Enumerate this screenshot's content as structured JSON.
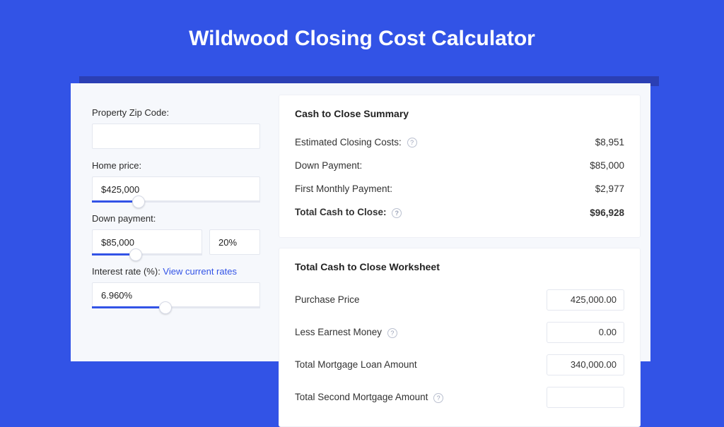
{
  "title": "Wildwood Closing Cost Calculator",
  "left": {
    "zip_label": "Property Zip Code:",
    "zip_value": "",
    "home_price_label": "Home price:",
    "home_price_value": "$425,000",
    "down_payment_label": "Down payment:",
    "down_payment_value": "$85,000",
    "down_payment_pct": "20%",
    "interest_label_prefix": "Interest rate (%): ",
    "interest_link": "View current rates",
    "interest_value": "6.960%"
  },
  "summary": {
    "heading": "Cash to Close Summary",
    "rows": [
      {
        "label": "Estimated Closing Costs:",
        "help": true,
        "value": "$8,951"
      },
      {
        "label": "Down Payment:",
        "help": false,
        "value": "$85,000"
      },
      {
        "label": "First Monthly Payment:",
        "help": false,
        "value": "$2,977"
      }
    ],
    "total_label": "Total Cash to Close:",
    "total_value": "$96,928"
  },
  "worksheet": {
    "heading": "Total Cash to Close Worksheet",
    "rows": [
      {
        "label": "Purchase Price",
        "help": false,
        "value": "425,000.00"
      },
      {
        "label": "Less Earnest Money",
        "help": true,
        "value": "0.00"
      },
      {
        "label": "Total Mortgage Loan Amount",
        "help": false,
        "value": "340,000.00"
      },
      {
        "label": "Total Second Mortgage Amount",
        "help": true,
        "value": ""
      }
    ]
  }
}
